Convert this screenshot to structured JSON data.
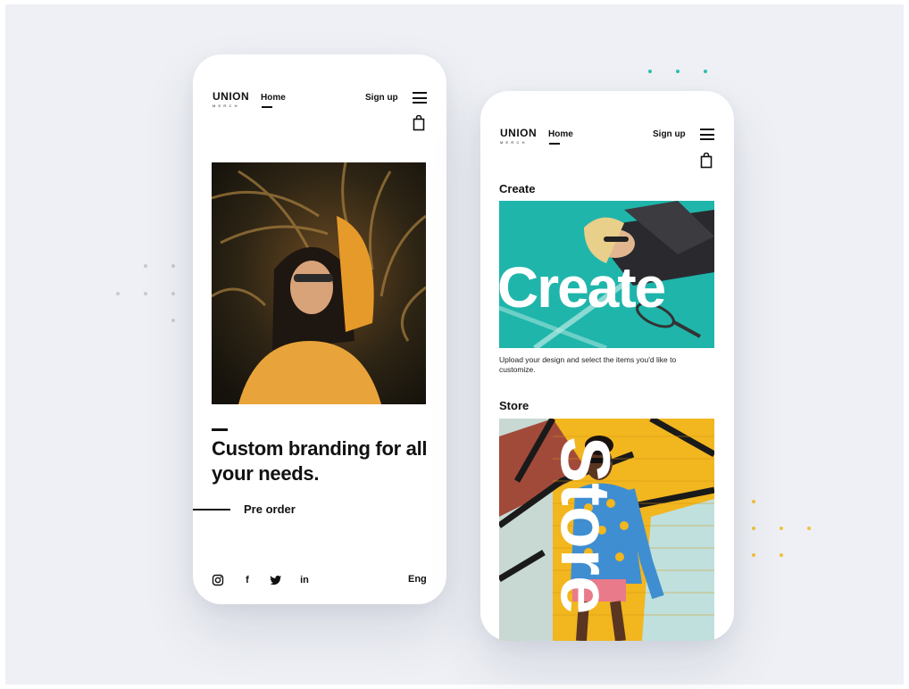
{
  "brand": {
    "name": "UNION",
    "sub": "MERCH"
  },
  "nav": {
    "home": "Home",
    "signup": "Sign up"
  },
  "icons": {
    "menu": "menu-icon",
    "bag": "shopping-bag-icon",
    "instagram": "instagram-icon",
    "facebook": "facebook-icon",
    "twitter": "twitter-icon",
    "linkedin": "linkedin-icon"
  },
  "landing": {
    "headline": "Custom branding for all your needs.",
    "cta": "Pre order",
    "social": {
      "facebook": "f",
      "linkedin": "in"
    },
    "language": "Eng"
  },
  "services": {
    "create": {
      "title": "Create",
      "overlay": "Create",
      "caption": "Upload your design and select the items you'd like to customize."
    },
    "store": {
      "title": "Store",
      "overlay": "Store"
    }
  },
  "colors": {
    "background": "#eef0f5",
    "teal": "#1fb5ab",
    "accent_teal_dot": "#2bbfb2",
    "accent_yellow_dot": "#f2c13a",
    "grey_dot": "#c9c9d3",
    "text": "#111111"
  }
}
